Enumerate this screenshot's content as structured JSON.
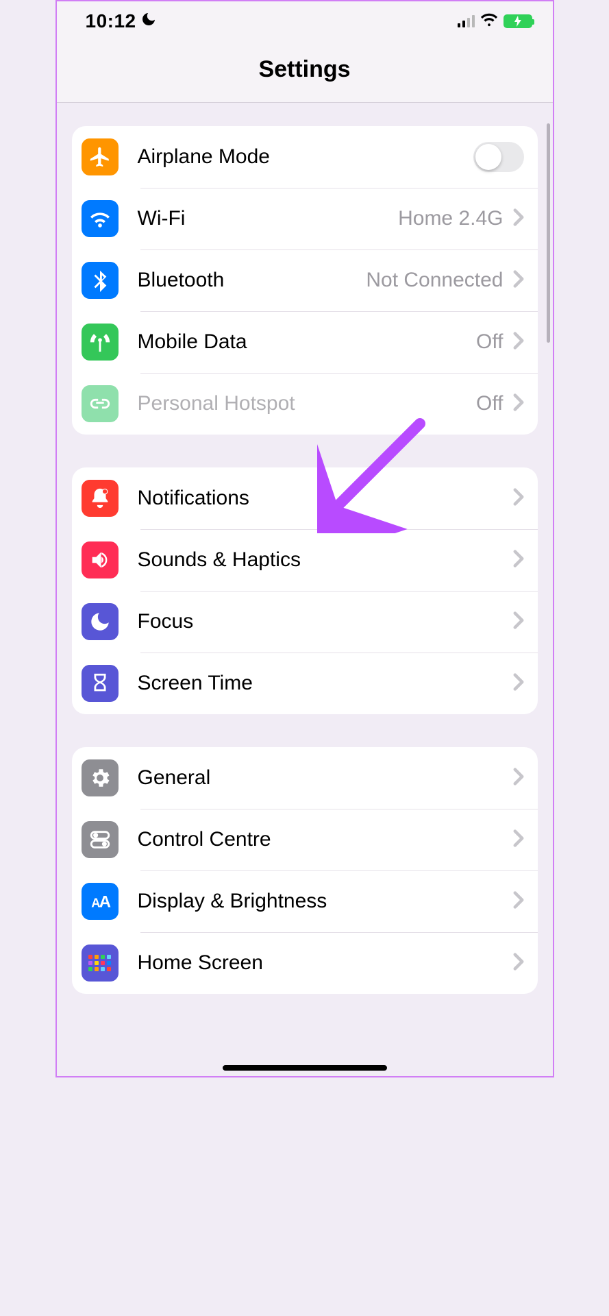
{
  "status": {
    "time": "10:12",
    "dnd": true
  },
  "header": {
    "title": "Settings"
  },
  "groups": [
    {
      "rows": [
        {
          "id": "airplane",
          "label": "Airplane Mode",
          "value": "",
          "toggle": false
        },
        {
          "id": "wifi",
          "label": "Wi-Fi",
          "value": "Home 2.4G"
        },
        {
          "id": "bluetooth",
          "label": "Bluetooth",
          "value": "Not Connected"
        },
        {
          "id": "mobiledata",
          "label": "Mobile Data",
          "value": "Off"
        },
        {
          "id": "hotspot",
          "label": "Personal Hotspot",
          "value": "Off",
          "dim": true
        }
      ]
    },
    {
      "rows": [
        {
          "id": "notifications",
          "label": "Notifications"
        },
        {
          "id": "sounds",
          "label": "Sounds & Haptics"
        },
        {
          "id": "focus",
          "label": "Focus"
        },
        {
          "id": "screentime",
          "label": "Screen Time"
        }
      ]
    },
    {
      "rows": [
        {
          "id": "general",
          "label": "General"
        },
        {
          "id": "controlc",
          "label": "Control Centre"
        },
        {
          "id": "display",
          "label": "Display & Brightness"
        },
        {
          "id": "homescreen",
          "label": "Home Screen"
        }
      ]
    }
  ]
}
